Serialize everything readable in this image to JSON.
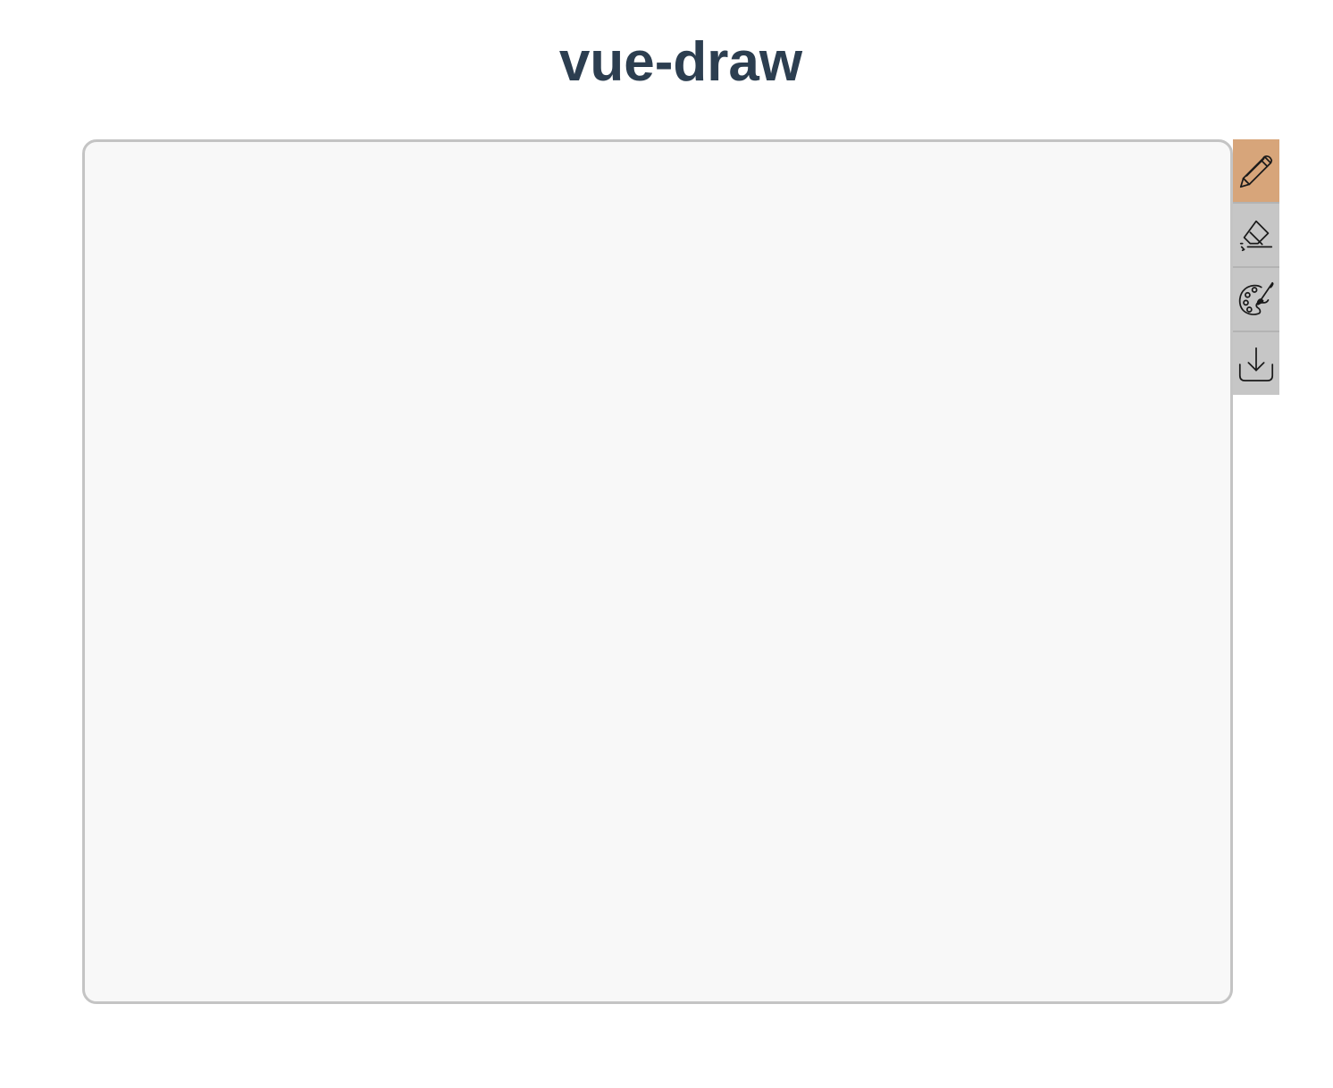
{
  "app": {
    "title": "vue-draw"
  },
  "toolbar": {
    "tools": [
      {
        "name": "pencil",
        "icon": "pencil-icon",
        "active": true
      },
      {
        "name": "eraser",
        "icon": "eraser-icon",
        "active": false
      },
      {
        "name": "palette",
        "icon": "palette-icon",
        "active": false
      },
      {
        "name": "download",
        "icon": "download-icon",
        "active": false
      }
    ]
  },
  "colors": {
    "title": "#2c3e50",
    "canvas_background": "#f8f8f8",
    "canvas_border": "#c4c4c4",
    "toolbar_background": "#c6c6c6",
    "active_tool_background": "#d7a57a"
  }
}
